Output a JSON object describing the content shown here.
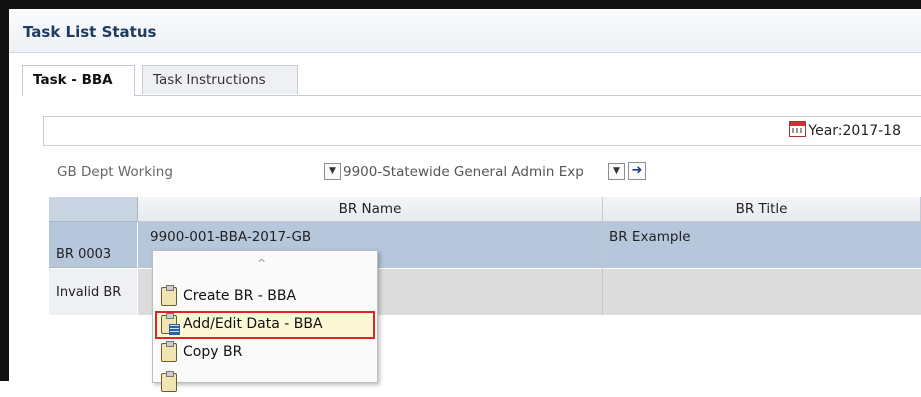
{
  "panel": {
    "title": "Task List Status"
  },
  "tabs": [
    {
      "label": "Task - BBA",
      "active": true
    },
    {
      "label": "Task Instructions",
      "active": false
    }
  ],
  "pov": {
    "year": "Year:2017-18"
  },
  "selectors": {
    "dept": "GB Dept Working",
    "entity": "9900-Statewide General Admin Exp"
  },
  "grid": {
    "columns": [
      "BR Name",
      "BR Title"
    ],
    "rows": [
      {
        "header": "BR 0003",
        "br_name": "9900-001-BBA-2017-GB",
        "br_title": "BR Example"
      },
      {
        "header": "Invalid BR",
        "br_name": "",
        "br_title": ""
      }
    ]
  },
  "context_menu": {
    "items": [
      {
        "label": "Create BR - BBA",
        "icon": "clipboard-check-icon"
      },
      {
        "label": "Add/Edit Data - BBA",
        "icon": "clipboard-grid-icon",
        "highlighted": true
      },
      {
        "label": "Copy BR",
        "icon": "clipboard-check-icon"
      },
      {
        "label": "",
        "icon": "clipboard-icon"
      }
    ]
  },
  "colors": {
    "title": "#1d3d63",
    "selected_row": "#b6c6db",
    "highlight_border": "#e02424"
  }
}
